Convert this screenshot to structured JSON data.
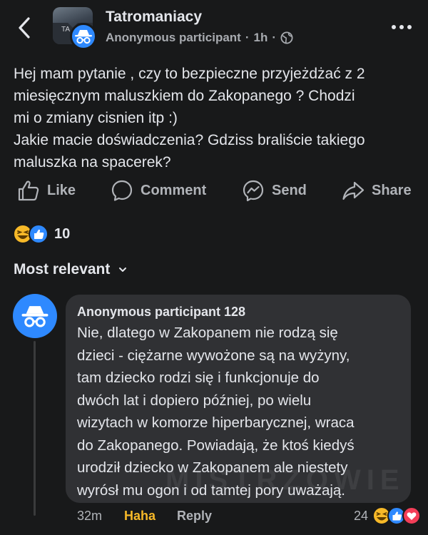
{
  "header": {
    "group_name": "Tatromaniacy",
    "author": "Anonymous participant",
    "separator": "·",
    "time": "1h",
    "separator2": "·",
    "audience_icon": "globe-icon",
    "avatar_label": "TA"
  },
  "post": {
    "text": "Hej mam pytanie , czy to bezpieczne przyjeżdżać z 2\nmiesięcznym  maluszkiem do Zakopanego ? Chodzi\nmi o zmiany cisnien itp :)\nJakie macie doświadczenia? Gdziss braliście takiego\nmaluszka na spacerek?"
  },
  "actions": {
    "like": "Like",
    "comment": "Comment",
    "send": "Send",
    "share": "Share"
  },
  "reactions": {
    "types": [
      "haha",
      "like"
    ],
    "count": "10"
  },
  "comments_sort": {
    "label": "Most relevant"
  },
  "comment": {
    "author": "Anonymous participant 128",
    "text": "Nie, dlatego w Zakopanem nie rodzą się\ndzieci - ciężarne wywożone są na wyżyny,\ntam dziecko rodzi się i funkcjonuje do\ndwóch lat i dopiero później, po wielu\nwizytach w komorze hiperbarycznej, wraca\ndo Zakopanego. Powiadają, że ktoś kiedyś\nurodził dziecko w Zakopanem ale niestety\nwyrósł mu ogon i od tamtej pory uważają.",
    "time": "32m",
    "reaction_label": "Haha",
    "reply_label": "Reply",
    "reaction_count": "24",
    "reaction_types": [
      "haha",
      "like",
      "love"
    ],
    "watermark": "MISTRZOWIE"
  },
  "colors": {
    "background": "#18191a",
    "accent": "#2e89ff",
    "haha": "#f7b928",
    "love": "#f33e58"
  }
}
